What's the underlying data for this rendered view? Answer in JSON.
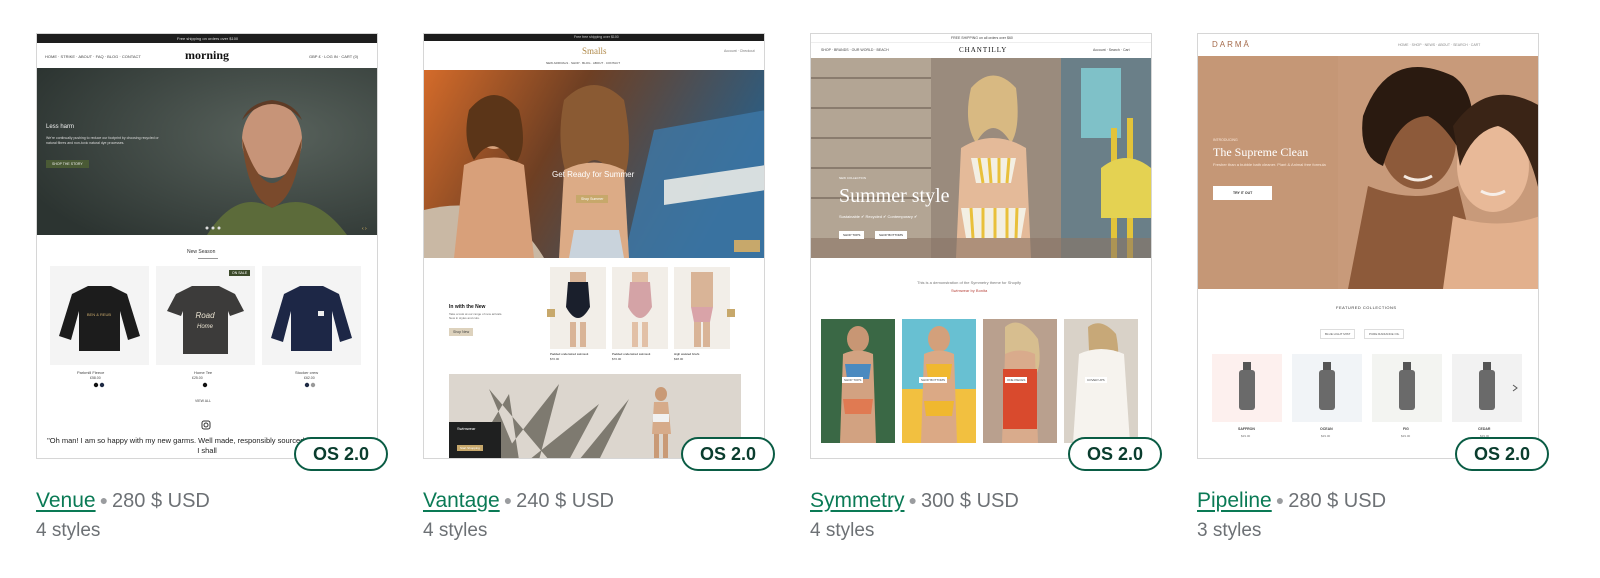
{
  "themes": [
    {
      "name": "Venue",
      "price": "280 $ USD",
      "styles": "4 styles",
      "badge": "OS 2.0",
      "preview": {
        "announcement": "Free shipping on orders over $100",
        "brand": "morning",
        "nav": [
          "HOME",
          "STRIKE",
          "ABOUT",
          "FAQ",
          "BLOG",
          "CONTACT"
        ],
        "account": [
          "GBP £",
          "LOG IN",
          "CART (0)"
        ],
        "hero_heading": "Less harm",
        "hero_text": "We're continually pushing to reduce our footprint by choosing recycled or natural fibres and non-toxic natural dye processes.",
        "hero_button": "SHOP THE STORY",
        "section_title": "New Season",
        "products": [
          {
            "name": "Parkmill Fleece",
            "price": "£58.00"
          },
          {
            "name": "Home Tee",
            "price": "£25.00"
          },
          {
            "name": "Stocker crew",
            "price": "£62.00"
          }
        ],
        "sale_badge": "ON SALE",
        "view_all": "VIEW ALL",
        "testimonial": "\"Oh man! I am so happy with my new garms. Well made, responsibly sourced and a great fit too. I shall"
      }
    },
    {
      "name": "Vantage",
      "price": "240 $ USD",
      "styles": "4 styles",
      "badge": "OS 2.0",
      "preview": {
        "announcement": "Free free shipping over $100",
        "brand": "Smalls",
        "nav": [
          "NEW ARRIVALS",
          "SHOP",
          "BLOG",
          "ABOUT",
          "CONTACT"
        ],
        "hero_heading": "Get Ready for Summer",
        "hero_button": "Shop Summer",
        "section_heading": "In with the New",
        "section_text": "Take a look at our range of new arrivals. New in styles and cuts.",
        "section_button": "Shop New",
        "products": [
          {
            "name": "Padded underwired swimsuit",
            "price": "$70.00"
          },
          {
            "name": "Padded underwired swimsuit",
            "price": "$70.00"
          },
          {
            "name": "High waisted briefs",
            "price": "$38.00"
          }
        ],
        "banner_heading": "Swimwear",
        "banner_button": "Start Shopping"
      }
    },
    {
      "name": "Symmetry",
      "price": "300 $ USD",
      "styles": "4 styles",
      "badge": "OS 2.0",
      "preview": {
        "announcement": "FREE SHIPPING on all orders over $60",
        "brand": "CHANTILLY",
        "nav": [
          "SHOP",
          "BRANDS",
          "OUR WORLD",
          "BEACH"
        ],
        "account": [
          "Account",
          "Search",
          "Cart"
        ],
        "hero_kicker": "NEW COLLECTION",
        "hero_heading": "Summer style",
        "hero_sub": "Sustainable ✔ Recycled ✔ Contemporary ✔",
        "hero_buttons": [
          "SHOP TOPS",
          "SHOP BOTTOMS"
        ],
        "demo_text": "This is a demonstration of the Symmetry theme for Shopify",
        "demo_credit": "Swimwear by Bonita",
        "tiles": [
          "SHOP TOPS",
          "SHOP BOTTOMS",
          "ONE PIECES",
          "COVER UPS"
        ]
      }
    },
    {
      "name": "Pipeline",
      "price": "280 $ USD",
      "styles": "3 styles",
      "badge": "OS 2.0",
      "preview": {
        "brand": "DARMĀ",
        "nav": [
          "HOME",
          "SHOP",
          "NEWS",
          "ABOUT",
          "SEARCH",
          "CART"
        ],
        "hero_kicker": "INTRODUCING",
        "hero_heading": "The Supreme Clean",
        "hero_text": "Fresher than a bubble bath cleaner. Plant & Animal free formula",
        "hero_button": "TRY IT OUT",
        "section_title": "FEATURED COLLECTIONS",
        "filters": [
          "BLUE LIGHT MIST",
          "PURE RADIANCE OIL"
        ],
        "products": [
          {
            "name": "SAFFRON",
            "price": "$29.00"
          },
          {
            "name": "OCEAN",
            "price": "$29.00"
          },
          {
            "name": "FIG",
            "price": "$29.00"
          },
          {
            "name": "CEDAR",
            "price": "$29.00"
          }
        ]
      }
    }
  ],
  "colors": {
    "link": "#0a7a55",
    "badge_border": "#0a5c44",
    "muted_text": "#6d7175"
  }
}
